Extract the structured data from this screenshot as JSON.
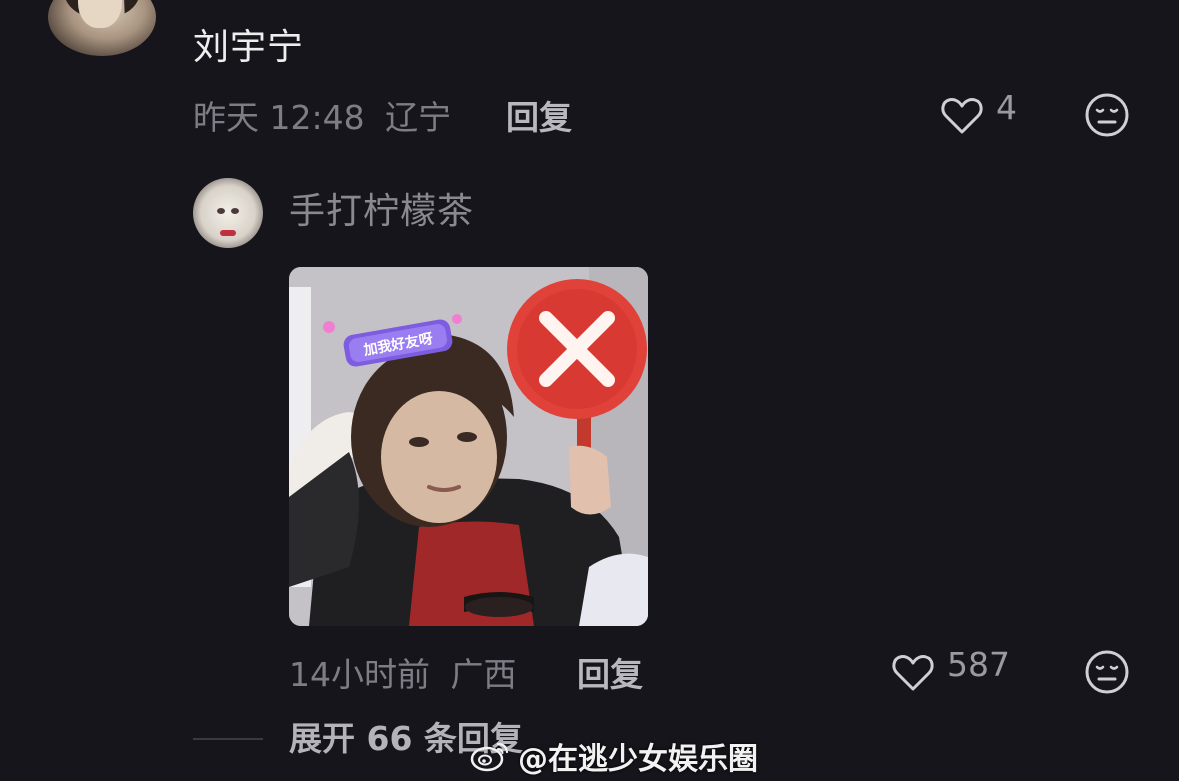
{
  "top_comment": {
    "username": "刘宇宁",
    "time": "昨天 12:48",
    "location": "辽宁",
    "reply_label": "回复",
    "likes": "4"
  },
  "sub_reply": {
    "username": "手打柠檬茶",
    "time": "14小时前",
    "location": "广西",
    "reply_label": "回复",
    "likes": "587",
    "meme_badge_text": "加我好友呀"
  },
  "expand_replies": "展开 66 条回复",
  "watermark": "@在逃少女娱乐圈",
  "colors": {
    "background": "#16151b",
    "primary_text": "#eeeeef",
    "secondary_text": "#7e7d85",
    "icon_stroke": "#d0cfd4",
    "red_sign": "#e0423a"
  },
  "icons": {
    "like": "heart-outline-icon",
    "dislike": "neutral-face-icon",
    "watermark_logo": "weibo-logo-icon"
  }
}
